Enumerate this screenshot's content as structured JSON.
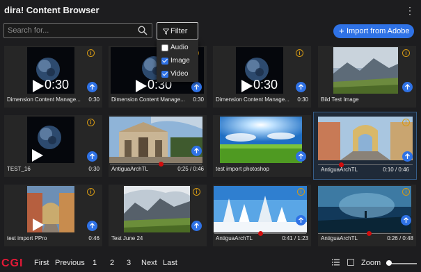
{
  "app": {
    "title": "dira! Content Browser",
    "menu_icon": "more-vertical-icon"
  },
  "toolbar": {
    "search_placeholder": "Search for...",
    "filter_label": "Filter",
    "import_label": "Import from Adobe",
    "accent": "#2f72e6"
  },
  "filter_menu": {
    "options": [
      {
        "label": "Audio",
        "checked": false
      },
      {
        "label": "Image",
        "checked": true
      },
      {
        "label": "Video",
        "checked": true
      }
    ]
  },
  "grid": {
    "items": [
      {
        "name": "Dimension Content Manage...",
        "duration": "0:30",
        "overlay_duration": "0:30",
        "type": "video"
      },
      {
        "name": "Dimension Content Manage...",
        "duration": "0:30",
        "overlay_duration": "0:30",
        "type": "video"
      },
      {
        "name": "Dimension Content Manage...",
        "duration": "0:30",
        "overlay_duration": "0:30",
        "type": "video"
      },
      {
        "name": "Bild Test Image",
        "duration": "",
        "type": "image"
      },
      {
        "name": "TEST_16",
        "duration": "0:30",
        "type": "video"
      },
      {
        "name": "AntiguaArchTL",
        "duration": "0:25 / 0:46",
        "type": "video",
        "progress": 0.54
      },
      {
        "name": "test import photoshop",
        "duration": "",
        "type": "image"
      },
      {
        "name": "AntiguaArchTL",
        "duration": "0:10 / 0:46",
        "type": "video",
        "progress": 0.22,
        "selected": true
      },
      {
        "name": "test import PPro",
        "duration": "0:46",
        "type": "video"
      },
      {
        "name": "Test June 24",
        "duration": "",
        "type": "image"
      },
      {
        "name": "AntiguaArchTL",
        "duration": "0:41 / 1:23",
        "type": "video",
        "progress": 0.49
      },
      {
        "name": "AntiguaArchTL",
        "duration": "0:26 / 0:48",
        "type": "video",
        "progress": 0.54
      }
    ]
  },
  "footer": {
    "logo": "CGI",
    "first": "First",
    "previous": "Previous",
    "pages": [
      "1",
      "2",
      "3"
    ],
    "current_page": "1",
    "next": "Next",
    "last": "Last",
    "zoom_label": "Zoom",
    "zoom_level": 0.0,
    "logo_color": "#e31937"
  }
}
